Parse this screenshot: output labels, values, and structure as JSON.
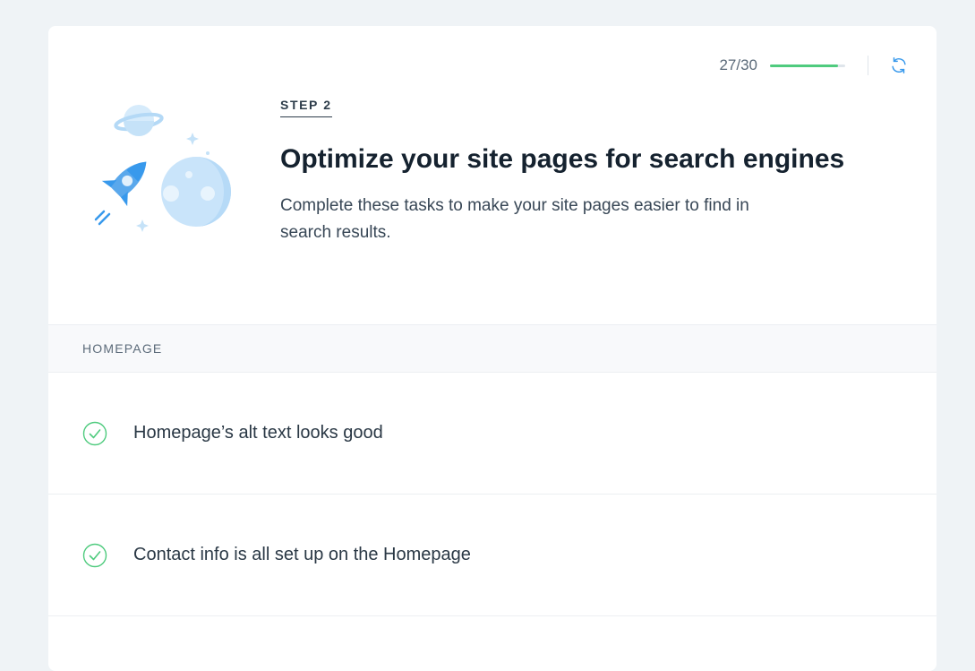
{
  "progress": {
    "score": "27/30",
    "fraction": 0.9,
    "fill_color": "#4fcb7e"
  },
  "icons": {
    "refresh": "refresh-icon",
    "illustration": "rocket-planet-illustration",
    "check": "check-circle-icon"
  },
  "header": {
    "step": "STEP 2",
    "title": "Optimize your site pages for search engines",
    "description": "Complete these tasks to make your site pages easier to find in search results."
  },
  "section": {
    "label": "HOMEPAGE"
  },
  "tasks": [
    {
      "label": "Homepage’s alt text looks good",
      "status": "done"
    },
    {
      "label": "Contact info is all set up on the Homepage",
      "status": "done"
    }
  ],
  "colors": {
    "accent": "#3899ec",
    "success": "#4fcb7e",
    "background": "#eff3f6"
  }
}
